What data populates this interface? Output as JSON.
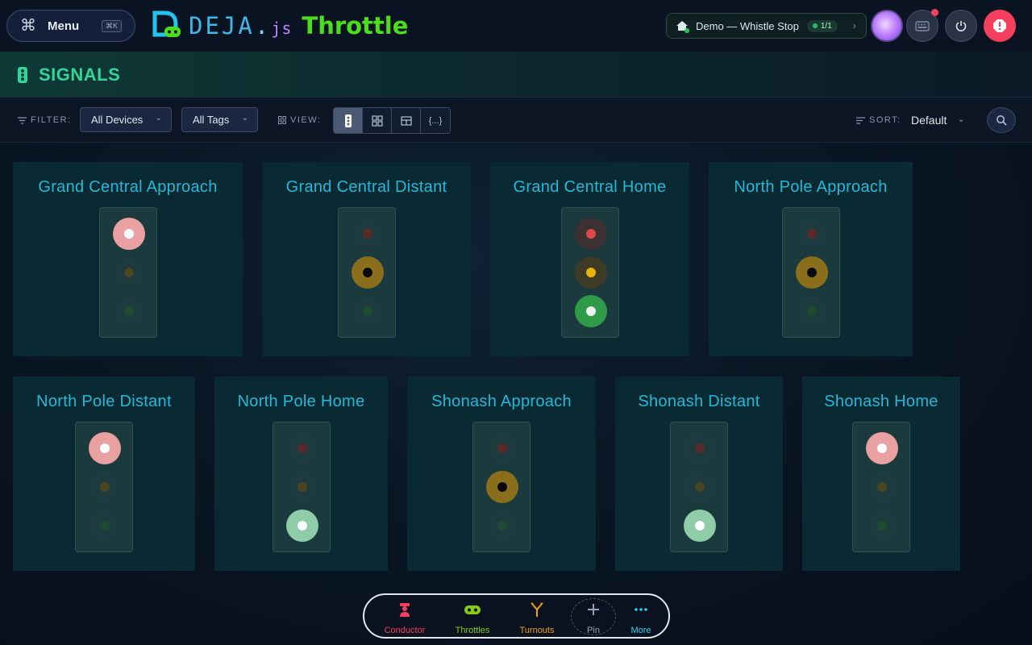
{
  "header": {
    "menu_label": "Menu",
    "menu_shortcut": "⌘K",
    "brand": {
      "deja": "DEJA",
      "dot": ".",
      "js": "js",
      "app": "Throttle"
    },
    "layout": {
      "name": "Demo — Whistle Stop",
      "count": "1/1"
    },
    "colors": {
      "estop": "#f43f5e",
      "notification": "#f43f5e"
    }
  },
  "page": {
    "title": "SIGNALS",
    "icon": "traffic-light-icon"
  },
  "toolbar": {
    "filter_label": "FILTER:",
    "devices": "All Devices",
    "tags": "All Tags",
    "view_label": "VIEW:",
    "json_view": "{...}",
    "sort_label": "SORT:",
    "sort_value": "Default"
  },
  "signals": [
    {
      "name": "Grand Central Approach",
      "aspect": "red"
    },
    {
      "name": "Grand Central Distant",
      "aspect": "yellow"
    },
    {
      "name": "Grand Central Home",
      "aspect": "all"
    },
    {
      "name": "North Pole Approach",
      "aspect": "yellow"
    },
    {
      "name": "North Pole Distant",
      "aspect": "red"
    },
    {
      "name": "North Pole Home",
      "aspect": "green"
    },
    {
      "name": "Shonash Approach",
      "aspect": "yellow"
    },
    {
      "name": "Shonash Distant",
      "aspect": "green"
    },
    {
      "name": "Shonash Home",
      "aspect": "red"
    }
  ],
  "bottom_nav": {
    "conductor": "Conductor",
    "throttles": "Throttles",
    "turnouts": "Turnouts",
    "pin": "Pin",
    "more": "More",
    "colors": {
      "conductor": "#f43f5e",
      "throttles": "#84cc16",
      "turnouts": "#f59e0b",
      "pin": "#94a3b8",
      "more": "#22d3ee"
    }
  }
}
